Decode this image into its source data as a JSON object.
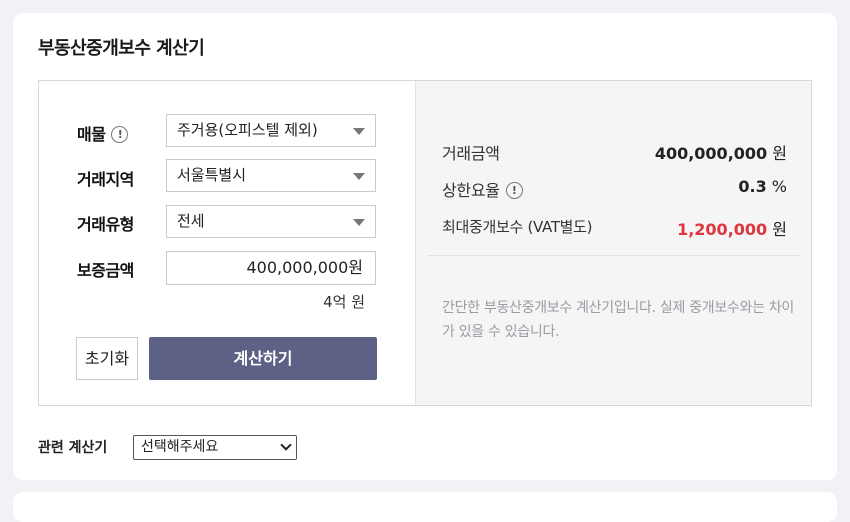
{
  "card": {
    "title": "부동산중개보수 계산기"
  },
  "form": {
    "property": {
      "label": "매물",
      "info": "!",
      "value": "주거용(오피스텔 제외)"
    },
    "region": {
      "label": "거래지역",
      "value": "서울특별시"
    },
    "type": {
      "label": "거래유형",
      "value": "전세"
    },
    "amount": {
      "label": "보증금액",
      "value": "400,000,000원",
      "hint": "4억 원"
    },
    "reset_label": "초기화",
    "calc_label": "계산하기"
  },
  "result": {
    "deal_amount": {
      "label": "거래금액",
      "value": "400,000,000",
      "unit": "원"
    },
    "rate": {
      "label": "상한요율",
      "info": "!",
      "value": "0.3",
      "unit": "%"
    },
    "max_fee": {
      "label": "최대중개보수 (VAT별도)",
      "value": "1,200,000",
      "unit": "원"
    },
    "note": "간단한 부동산중개보수 계산기입니다. 실제 중개보수와는 차이가 있을 수 있습니다."
  },
  "related": {
    "label": "관련 계산기",
    "value": "선택해주세요"
  },
  "colors": {
    "accent": "#5c6185",
    "highlight": "#e0353f"
  }
}
